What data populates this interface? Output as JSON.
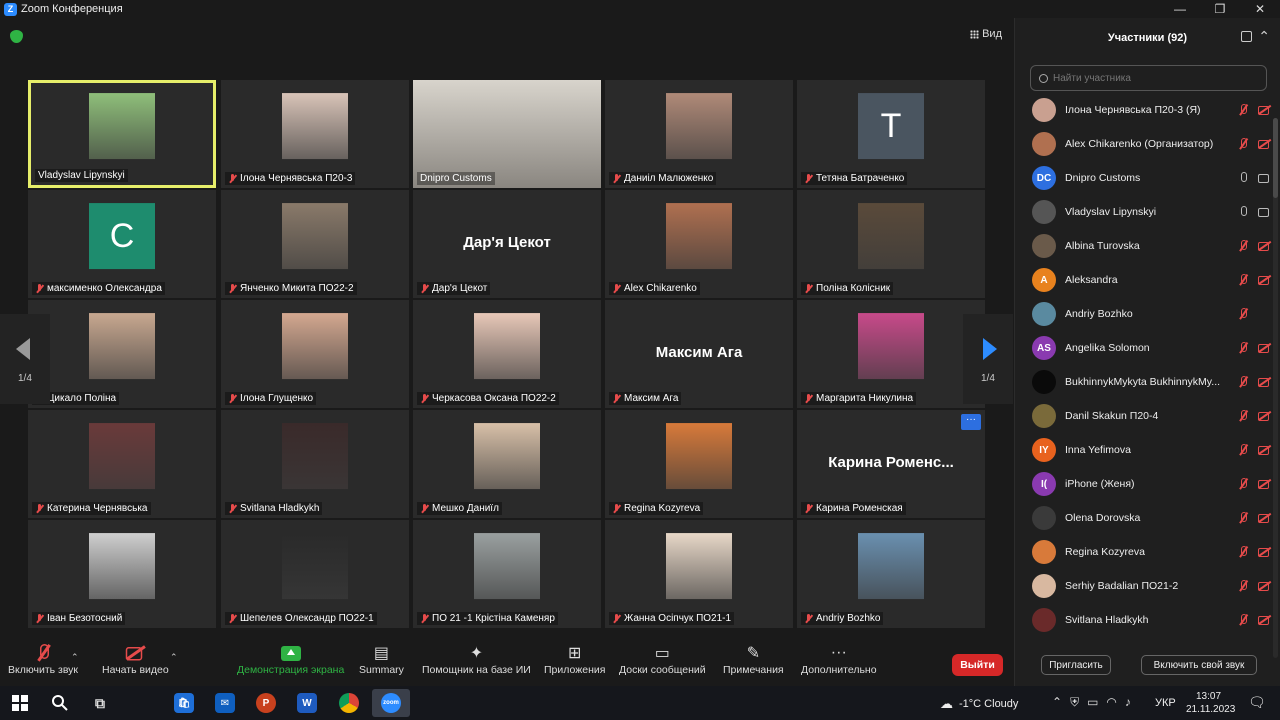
{
  "window": {
    "title": "Zoom Конференция"
  },
  "view_label": "Вид",
  "pagination": {
    "left": "1/4",
    "right": "1/4"
  },
  "tiles": [
    {
      "name": "Vladyslav Lipynskyi",
      "muted": false,
      "kind": "photo",
      "color": "#8fbf7a"
    },
    {
      "name": "Ілона Чернявська П20-3",
      "muted": true,
      "kind": "photo",
      "color": "#d9c4b8"
    },
    {
      "name": "Dnipro Customs",
      "muted": false,
      "kind": "wide",
      "color": "#b9b3a8"
    },
    {
      "name": "Даниіл Малюженко",
      "muted": true,
      "kind": "photo",
      "color": "#b08a78"
    },
    {
      "name": "Тетяна Батраченко",
      "muted": true,
      "kind": "avatar",
      "initial": "T",
      "color": "#4a5560"
    },
    {
      "name": "максименко Олександра",
      "muted": true,
      "kind": "avatar",
      "initial": "C",
      "color": "#1e8c6e"
    },
    {
      "name": "Янченко Микита ПО22-2",
      "muted": true,
      "kind": "photo",
      "color": "#8a7a6a"
    },
    {
      "name": "Дар'я Цекот",
      "muted": true,
      "kind": "text",
      "display": "Дар'я Цекот"
    },
    {
      "name": "Alex Chikarenko",
      "muted": true,
      "kind": "photo",
      "color": "#b07050"
    },
    {
      "name": "Поліна Колісник",
      "muted": true,
      "kind": "photo",
      "color": "#5a4a3a"
    },
    {
      "name": "Цикало Поліна",
      "muted": true,
      "kind": "photo",
      "color": "#c8a890"
    },
    {
      "name": "Ілона Глущенко",
      "muted": true,
      "kind": "photo",
      "color": "#d4a890"
    },
    {
      "name": "Черкасова Оксана ПО22-2",
      "muted": true,
      "kind": "photo",
      "color": "#e8c8b8"
    },
    {
      "name": "Максим Ага",
      "muted": true,
      "kind": "text",
      "display": "Максим Ага"
    },
    {
      "name": "Маргарита Никулина",
      "muted": true,
      "kind": "photo",
      "color": "#c84a8a"
    },
    {
      "name": "Катерина Чернявська",
      "muted": true,
      "kind": "photo",
      "color": "#6a3a3a"
    },
    {
      "name": "Svitlana Hladkykh",
      "muted": true,
      "kind": "photo",
      "color": "#3a2a2a"
    },
    {
      "name": "Мешко Даниїл",
      "muted": true,
      "kind": "photo",
      "color": "#d8c0a8"
    },
    {
      "name": "Regina Kozyreva",
      "muted": true,
      "kind": "photo",
      "color": "#d87a3a"
    },
    {
      "name": "Карина Роменская",
      "muted": true,
      "kind": "text",
      "display": "Карина  Роменс..."
    },
    {
      "name": "Іван Безотосний",
      "muted": true,
      "kind": "photo",
      "color": "#cfcfcf"
    },
    {
      "name": "Шепелев Олександр  ПО22-1",
      "muted": true,
      "kind": "photo",
      "color": "#2a2a2a"
    },
    {
      "name": "ПО 21 -1 Крістіна Каменяр",
      "muted": true,
      "kind": "photo",
      "color": "#9aa0a0"
    },
    {
      "name": "Жанна Осіпчук ПО21-1",
      "muted": true,
      "kind": "photo",
      "color": "#e8d8c8"
    },
    {
      "name": "Andriy Bozhko",
      "muted": true,
      "kind": "photo",
      "color": "#6a90b0"
    }
  ],
  "panel": {
    "title": "Участники (92)",
    "search_placeholder": "Найти участника",
    "participants": [
      {
        "name": "Ілона Чернявська П20-3 (Я)",
        "initials": "",
        "color": "#c9a090",
        "mic": "off",
        "cam": "off"
      },
      {
        "name": "Alex Chikarenko (Организатор)",
        "initials": "",
        "color": "#b07050",
        "mic": "off",
        "cam": "off"
      },
      {
        "name": "Dnipro Customs",
        "initials": "DC",
        "color": "#2d6fe0",
        "mic": "on",
        "cam": "on"
      },
      {
        "name": "Vladyslav Lipynskyi",
        "initials": "",
        "color": "#555555",
        "mic": "on",
        "cam": "on"
      },
      {
        "name": "Albina Turovska",
        "initials": "",
        "color": "#6a5a4a",
        "mic": "off",
        "cam": "off"
      },
      {
        "name": "Aleksandra",
        "initials": "A",
        "color": "#e8821e",
        "mic": "off",
        "cam": "off"
      },
      {
        "name": "Andriy Bozhko",
        "initials": "",
        "color": "#5a8aa0",
        "mic": "off",
        "cam": "none"
      },
      {
        "name": "Angelika Solomon",
        "initials": "AS",
        "color": "#8a3ab0",
        "mic": "off",
        "cam": "off"
      },
      {
        "name": "BukhinnykMykyta BukhinnykMy...",
        "initials": "",
        "color": "#0a0a0a",
        "mic": "off",
        "cam": "off"
      },
      {
        "name": "Danil Skakun П20-4",
        "initials": "",
        "color": "#7a6a3a",
        "mic": "off",
        "cam": "off"
      },
      {
        "name": "Inna Yefimova",
        "initials": "IY",
        "color": "#e8621e",
        "mic": "off",
        "cam": "off"
      },
      {
        "name": "iPhone (Женя)",
        "initials": "I(",
        "color": "#8a3ab0",
        "mic": "off",
        "cam": "off"
      },
      {
        "name": "Olena Dorovska",
        "initials": "",
        "color": "#3a3a3a",
        "mic": "off",
        "cam": "off"
      },
      {
        "name": "Regina Kozyreva",
        "initials": "",
        "color": "#d87a3a",
        "mic": "off",
        "cam": "off"
      },
      {
        "name": "Serhiy Badalian ПО21-2",
        "initials": "",
        "color": "#d8b8a0",
        "mic": "off",
        "cam": "off"
      },
      {
        "name": "Svitlana Hladkykh",
        "initials": "",
        "color": "#6a2a2a",
        "mic": "off",
        "cam": "off"
      }
    ],
    "invite_label": "Пригласить",
    "unmute_label": "Включить свой звук"
  },
  "toolbar": {
    "audio": "Включить звук",
    "video": "Начать видео",
    "share": "Демонстрация экрана",
    "summary": "Summary",
    "ai": "Помощник на базе ИИ",
    "apps": "Приложения",
    "whiteboards": "Доски сообщений",
    "notes": "Примечания",
    "more": "Дополнительно",
    "leave": "Выйти"
  },
  "taskbar": {
    "weather": "-1°C  Cloudy",
    "lang": "УКР",
    "time": "13:07",
    "date": "21.11.2023",
    "zoom_label": "zoom"
  }
}
